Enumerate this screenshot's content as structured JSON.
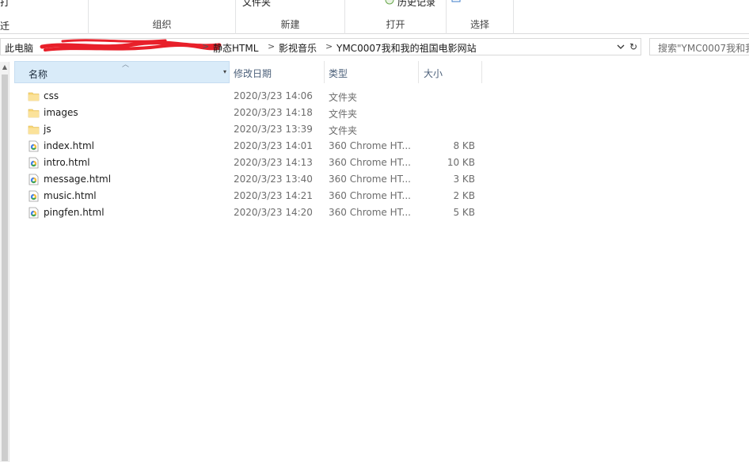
{
  "ribbon": {
    "partial_left": "打",
    "partial_left2": "迁",
    "partial_folder": "文件夹",
    "partial_history": "历史记录",
    "groups": [
      {
        "label": "组织"
      },
      {
        "label": "新建"
      },
      {
        "label": "打开"
      },
      {
        "label": "选择"
      }
    ]
  },
  "address": {
    "crumbs": [
      "此电脑",
      "静态HTML",
      "影视音乐",
      "YMC0007我和我的祖国电影网站"
    ],
    "separator": ">"
  },
  "search": {
    "placeholder": "搜索\"YMC0007我和我"
  },
  "columns": {
    "name": "名称",
    "date": "修改日期",
    "type": "类型",
    "size": "大小"
  },
  "files": [
    {
      "name": "css",
      "date": "2020/3/23 14:06",
      "type": "文件夹",
      "size": "",
      "icon": "folder-icon"
    },
    {
      "name": "images",
      "date": "2020/3/23 14:18",
      "type": "文件夹",
      "size": "",
      "icon": "folder-icon"
    },
    {
      "name": "js",
      "date": "2020/3/23 13:39",
      "type": "文件夹",
      "size": "",
      "icon": "folder-icon"
    },
    {
      "name": "index.html",
      "date": "2020/3/23 14:01",
      "type": "360 Chrome HT...",
      "size": "8 KB",
      "icon": "html-file-icon"
    },
    {
      "name": "intro.html",
      "date": "2020/3/23 14:13",
      "type": "360 Chrome HT...",
      "size": "10 KB",
      "icon": "html-file-icon"
    },
    {
      "name": "message.html",
      "date": "2020/3/23 13:40",
      "type": "360 Chrome HT...",
      "size": "3 KB",
      "icon": "html-file-icon"
    },
    {
      "name": "music.html",
      "date": "2020/3/23 14:21",
      "type": "360 Chrome HT...",
      "size": "2 KB",
      "icon": "html-file-icon"
    },
    {
      "name": "pingfen.html",
      "date": "2020/3/23 14:20",
      "type": "360 Chrome HT...",
      "size": "5 KB",
      "icon": "html-file-icon"
    }
  ],
  "colors": {
    "header_selected_bg": "#d9ebf9",
    "folder": "#f8d775",
    "redaction": "#e8202a"
  }
}
